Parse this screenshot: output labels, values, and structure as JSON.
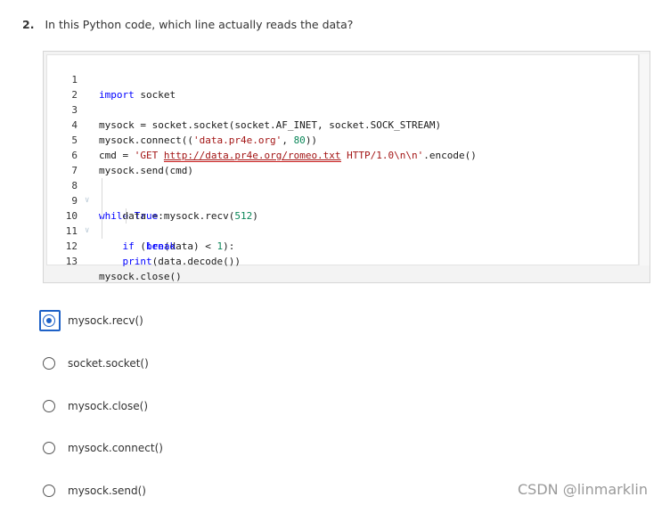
{
  "question": {
    "number": "2.",
    "text": "In this Python code, which line actually reads the data?"
  },
  "code": {
    "line_numbers": [
      "1",
      "2",
      "3",
      "4",
      "5",
      "6",
      "7",
      "8",
      "9",
      "10",
      "11",
      "12",
      "13"
    ],
    "lines": [
      "import socket",
      "",
      "mysock = socket.socket(socket.AF_INET, socket.SOCK_STREAM)",
      "mysock.connect(('data.pr4e.org', 80))",
      "cmd = 'GET http://data.pr4e.org/romeo.txt HTTP/1.0\\n\\n'.encode()",
      "mysock.send(cmd)",
      "",
      "while True:",
      "    data = mysock.recv(512)",
      "    if (len(data) < 1):",
      "        break",
      "    print(data.decode())",
      "mysock.close()"
    ]
  },
  "options": [
    {
      "label": "mysock.recv()",
      "selected": true
    },
    {
      "label": "socket.socket()",
      "selected": false
    },
    {
      "label": "mysock.close()",
      "selected": false
    },
    {
      "label": "mysock.connect()",
      "selected": false
    },
    {
      "label": "mysock.send()",
      "selected": false
    }
  ],
  "watermark": "CSDN @linmarklin",
  "colors": {
    "accent": "#1e61c7",
    "keyword": "#0000ff",
    "string": "#a31515",
    "number": "#098658"
  }
}
